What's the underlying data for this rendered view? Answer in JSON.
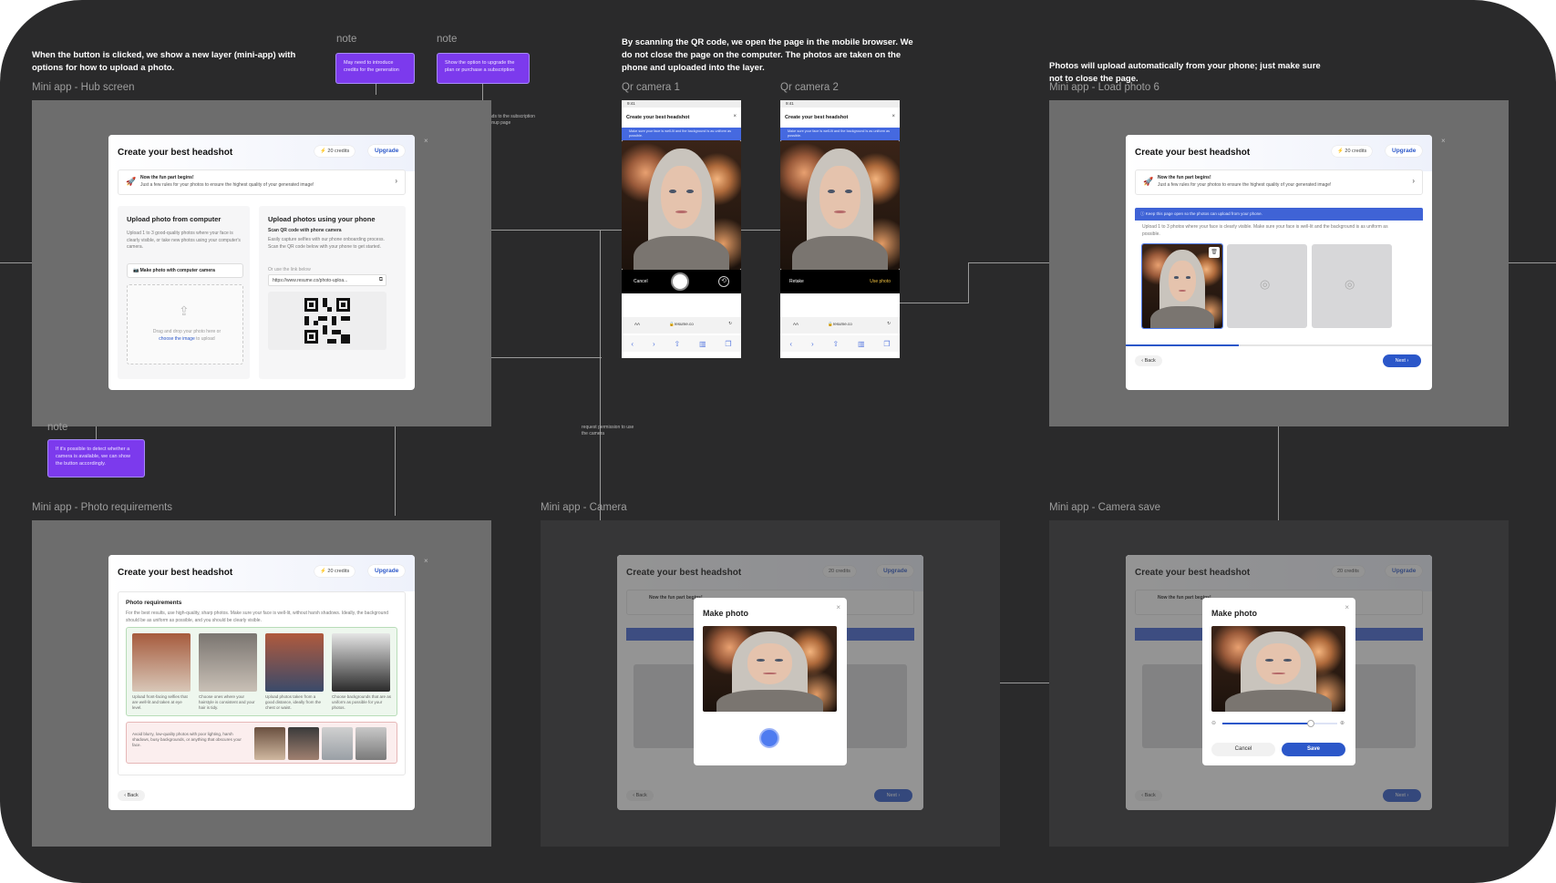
{
  "notes": {
    "intro": "When the button is clicked, we show a new layer (mini-app) with options for how to upload a photo.",
    "qr": "By scanning the QR code, we open the page in the mobile browser. We do not close the page on the computer. The photos are taken on the phone and uploaded into the layer.",
    "load": "Photos will upload automatically from your phone; just make sure not to close the page.",
    "note_label": "note",
    "sticky1": "May need to introduce credits for the generation",
    "sticky2": "Show the option to upgrade the plan or purchase a subscription",
    "sticky3": "If it's possible to detect whether a camera is available, we can show the button accordingly.",
    "leads": "leads to the subscription signup page",
    "request": "request permission to use the camera"
  },
  "frames": {
    "hub": "Mini app - Hub screen",
    "qr1": "Qr camera 1",
    "qr2": "Qr camera 2",
    "load": "Mini app - Load photo 6",
    "req": "Mini app - Photo requirements",
    "camera": "Mini app - Camera",
    "camsave": "Mini app - Camera save"
  },
  "modal": {
    "title": "Create your best headshot",
    "credits": "20 credits",
    "upgrade": "Upgrade",
    "close": "×",
    "notice_title": "Now the fun part begins!",
    "notice_sub": "Just a few rules for your photos to ensure the highest quality of your generated image!",
    "back": "Back",
    "next": "Next"
  },
  "hub": {
    "left_title": "Upload photo from computer",
    "left_text": "Upload 1 to 3 good-quality photos where your face is clearly visible, or take new photos using your computer's camera.",
    "camera_btn": "Make photo with computer camera",
    "drop_text": "Drag and drop your photo here or",
    "drop_link": "choose the image",
    "drop_end": "to upload",
    "right_title": "Upload photos using your phone",
    "right_sub": "Scan QR code with phone camera",
    "right_text": "Easily capture selfies with our phone onboarding process. Scan the QR code below with your phone to get started.",
    "link_label": "Or use the link below",
    "link_value": "https://www.resume.co/photo-uploa..."
  },
  "phone": {
    "time": "9:41",
    "title": "Create your best headshot",
    "info": "Make sure your face is well-lit and the background is as uniform as possible.",
    "cancel": "Cancel",
    "retake": "Retake",
    "use": "Use photo",
    "aa": "AA",
    "url": "resume.co"
  },
  "load": {
    "banner": "Keep this page open so the photos can upload from your phone.",
    "text": "Upload 1 to 3 photos where your face is clearly visible. Make sure your face is well-lit and the background is as uniform as possible."
  },
  "req": {
    "title": "Photo requirements",
    "text": "For the best results, use high-quality, sharp photos. Make sure your face is well-lit, without harsh shadows. Ideally, the background should be as uniform as possible, and you should be clearly visible.",
    "c1": "Upload front-facing selfies that are well-lit and taken at eye level.",
    "c2": "Choose ones where your hairstyle is consistent and your hair is tidy.",
    "c3": "Upload photos taken from a good distance, ideally from the chest or waist.",
    "c4": "Choose backgrounds that are as uniform as possible for your photos.",
    "bad": "Avoid blurry, low-quality photos with poor lighting, harsh shadows, busy backgrounds, or anything that obscures your face."
  },
  "cam": {
    "title": "Make photo",
    "cancel": "Cancel",
    "save": "Save"
  }
}
